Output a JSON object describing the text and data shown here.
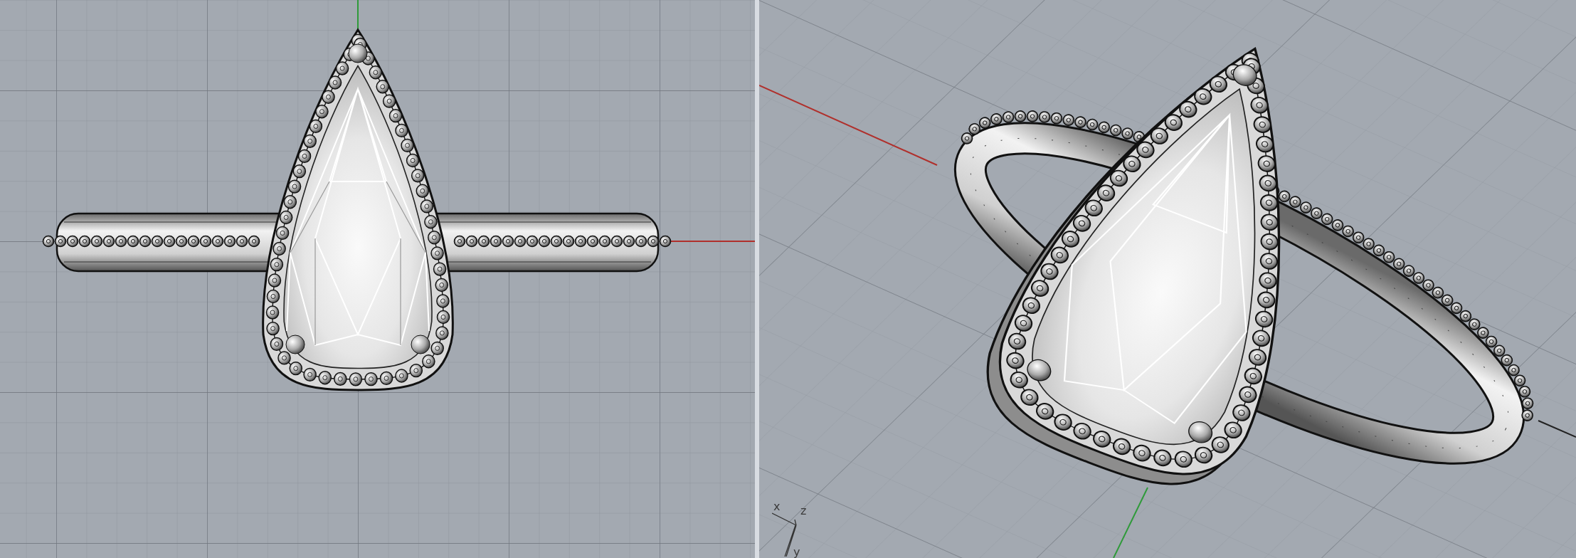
{
  "viewports": [
    {
      "kind": "top"
    },
    {
      "kind": "perspective",
      "gizmo": {
        "x": "x",
        "z": "z",
        "y": "y"
      }
    }
  ]
}
